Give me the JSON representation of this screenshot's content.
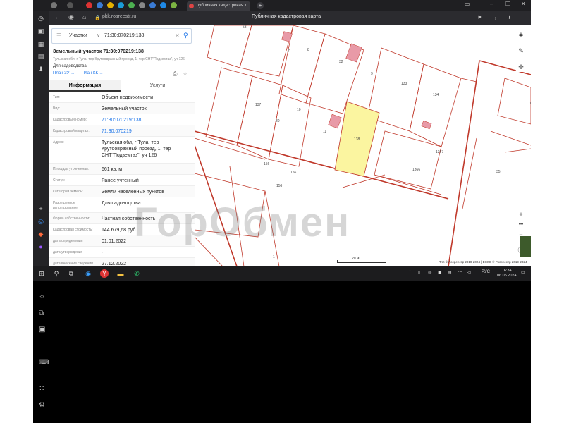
{
  "browser": {
    "tab_title": "публичная кадастровая к",
    "page_title": "Публичная кадастровая карта",
    "url": "pkk.rosreestr.ru"
  },
  "search": {
    "category": "Участки",
    "query": "71:30:070219:138"
  },
  "object": {
    "title": "Земельный участок 71:30:070219:138",
    "address_short": "Тульская обл, г Тула, тер Крутоовражный проезд, 1, тер СНТ\"Подземгаз\", уч 126",
    "purpose": "Для садоводства",
    "plan_zu": "План ЗУ →",
    "plan_kk": "План КК →"
  },
  "tabs": [
    "Информация",
    "Услуги"
  ],
  "info_rows": [
    {
      "key": "Тип:",
      "value": "Объект недвижимости",
      "link": false
    },
    {
      "key": "Вид:",
      "value": "Земельный участок",
      "link": false
    },
    {
      "key": "Кадастровый номер:",
      "value": "71:30:070219:138",
      "link": true
    },
    {
      "key": "Кадастровый квартал:",
      "value": "71:30:070219",
      "link": true
    },
    {
      "key": "Адрес:",
      "value": "Тульская обл, г Тула, тер Крутоовражный проезд, 1, тер СНТ\"Подземгаз\", уч 126",
      "link": false
    },
    {
      "key": "Площадь уточненная:",
      "value": "661 кв. м",
      "link": false
    },
    {
      "key": "Статус:",
      "value": "Ранее учтенный",
      "link": false
    },
    {
      "key": "Категория земель:",
      "value": "Земли населённых пунктов",
      "link": false
    },
    {
      "key": "Разрешенное использование:",
      "value": "Для садоводства",
      "link": false
    },
    {
      "key": "Форма собственности:",
      "value": "Частная собственность",
      "link": false
    },
    {
      "key": "Кадастровая стоимость:",
      "value": "144 679,68 руб.",
      "link": false
    },
    {
      "key": "дата определения",
      "value": "01.01.2022",
      "link": false
    },
    {
      "key": "дата утверждения",
      "value": "-",
      "link": false
    },
    {
      "key": "дата внесения сведений",
      "value": "27.12.2022",
      "link": false
    }
  ],
  "map": {
    "watermark": "ГорОбмен",
    "scale": "20 м",
    "copyright": "ПКК © Росреестр 2010-2024 | ЕЭКО © Росреестр 2019-2024",
    "highlight_color": "#fbf5a0",
    "boundary_color": "#c0392b",
    "labels": [
      {
        "text": "53"
      },
      {
        "text": "7"
      },
      {
        "text": "8"
      },
      {
        "text": "32"
      },
      {
        "text": "9"
      },
      {
        "text": "133"
      },
      {
        "text": "134"
      },
      {
        "text": "137"
      },
      {
        "text": "10"
      },
      {
        "text": "30"
      },
      {
        "text": "11"
      },
      {
        "text": "138"
      },
      {
        "text": "1367"
      },
      {
        "text": "156"
      },
      {
        "text": "156"
      },
      {
        "text": "1366"
      },
      {
        "text": "156"
      },
      {
        "text": "35"
      },
      {
        "text": "111"
      },
      {
        "text": "1"
      }
    ]
  },
  "taskbar": {
    "lang": "РУС",
    "time": "16:34",
    "date": "06.05.2024"
  }
}
